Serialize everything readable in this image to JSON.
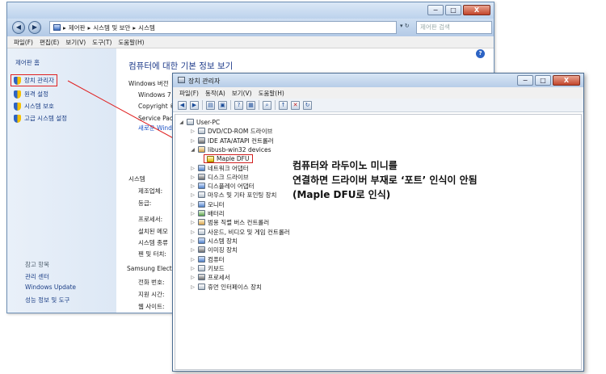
{
  "back_window": {
    "address_path": [
      "제어판",
      "시스템 및 보안",
      "시스템"
    ],
    "search_placeholder": "제어판 검색",
    "caption": {
      "minimize": "−",
      "maximize": "□",
      "close": "X"
    },
    "menu": [
      "파일(F)",
      "편집(E)",
      "보기(V)",
      "도구(T)",
      "도움말(H)"
    ],
    "sidebar": {
      "home": "제어판 홈",
      "tasks": [
        "장치 관리자",
        "원격 설정",
        "시스템 보호",
        "고급 시스템 설정"
      ],
      "see_also_heading": "참고 항목",
      "see_also": [
        "관리 센터",
        "Windows Update",
        "성능 정보 및 도구"
      ]
    },
    "main": {
      "title": "컴퓨터에 대한 기본 정보 보기",
      "windows_edition_heading": "Windows 버전",
      "edition_lines": [
        "Windows 7",
        "Copyright ©",
        "Service Pack",
        "새로운 Wind"
      ],
      "system_heading": "시스템",
      "system_labels": [
        "제조업체:",
        "등급:",
        "프로세서:",
        "설치된 메모",
        "시스템 종류",
        "펜 및 터치:"
      ],
      "support_heading": "Samsung Electr",
      "support_labels": [
        "전화 번호:",
        "지원 시간:",
        "웹 사이트:"
      ]
    },
    "help_icon": "?"
  },
  "device_manager": {
    "title": "장치 관리자",
    "caption": {
      "minimize": "−",
      "maximize": "□",
      "close": "X"
    },
    "menu": [
      "파일(F)",
      "동작(A)",
      "보기(V)",
      "도움말(H)"
    ],
    "toolbar_icons": [
      "back-icon",
      "forward-icon",
      "properties-icon",
      "refresh-icon",
      "help-icon",
      "view-icon",
      "scan-icon",
      "update-driver-icon",
      "uninstall-icon",
      "enable-icon"
    ],
    "tree": {
      "root": "User-PC",
      "nodes": [
        "DVD/CD-ROM 드라이브",
        "IDE ATA/ATAPI 컨트롤러",
        "libusb-win32 devices",
        "Maple DFU",
        "네트워크 어댑터",
        "디스크 드라이브",
        "디스플레이 어댑터",
        "마우스 및 기타 포인팅 장치",
        "모니터",
        "배터리",
        "범용 직렬 버스 컨트롤러",
        "사운드, 비디오 및 게임 컨트롤러",
        "시스템 장치",
        "이미징 장치",
        "컴퓨터",
        "키보드",
        "프로세서",
        "휴먼 인터페이스 장치"
      ]
    }
  },
  "annotation": {
    "lines": [
      "컴퓨터와 라두이노 미니를",
      "연결하면 드라이버 부재로 ‘포트’ 인식이 안됨",
      "(Maple DFU로 인식)"
    ]
  },
  "colors": {
    "highlight": "#e02020",
    "link": "#1c3f86",
    "title_blue": "#1e3b8a"
  }
}
